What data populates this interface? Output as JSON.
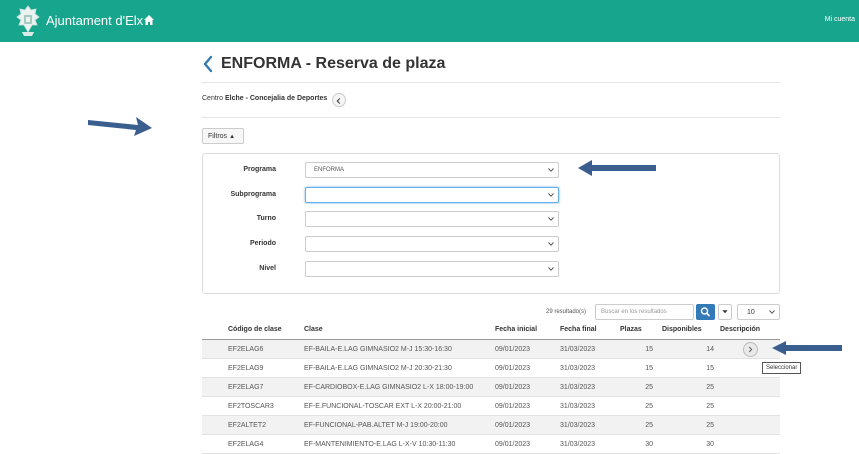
{
  "header": {
    "app_title": "Ajuntament d'Elx",
    "account_label": "Mi cuenta",
    "color": "#18a58d"
  },
  "page": {
    "title": "ENFORMA - Reserva de plaza",
    "centro_prefix": "Centro",
    "centro_name": "Elche - Concejalia de Deportes"
  },
  "filters": {
    "toggle_label": "Filtros",
    "fields": [
      {
        "label": "Programa",
        "value": "ENFORMA"
      },
      {
        "label": "Subprograma",
        "value": ""
      },
      {
        "label": "Turno",
        "value": ""
      },
      {
        "label": "Periodo",
        "value": ""
      },
      {
        "label": "Nivel",
        "value": ""
      }
    ]
  },
  "results": {
    "count_text": "29 resultado(s)",
    "search_placeholder": "Buscar en los resultados",
    "page_size": "10"
  },
  "table": {
    "columns": [
      "Código de clase",
      "Clase",
      "Fecha inicial",
      "Fecha final",
      "Plazas",
      "Disponibles",
      "Descripción"
    ],
    "rows": [
      [
        "EF2ELAG6",
        "EF-BAILA-E.LAG GIMNASIO2 M-J 15:30-16:30",
        "09/01/2023",
        "31/03/2023",
        "15",
        "14"
      ],
      [
        "EF2ELAG9",
        "EF-BAILA-E.LAG GIMNASIO2 M-J 20:30-21:30",
        "09/01/2023",
        "31/03/2023",
        "15",
        "15"
      ],
      [
        "EF2ELAG7",
        "EF-CARDIOBOX-E.LAG GIMNASIO2 L-X 18:00-19:00",
        "09/01/2023",
        "31/03/2023",
        "25",
        "25"
      ],
      [
        "EF2TOSCAR3",
        "EF-E.FUNCIONAL-TOSCAR EXT L-X 20:00-21:00",
        "09/01/2023",
        "31/03/2023",
        "25",
        "25"
      ],
      [
        "EF2ALTET2",
        "EF-FUNCIONAL-PAB.ALTET M-J 19:00-20:00",
        "09/01/2023",
        "31/03/2023",
        "25",
        "25"
      ],
      [
        "EF2ELAG4",
        "EF-MANTENIMIENTO-E.LAG L-X-V 10:30-11:30",
        "09/01/2023",
        "31/03/2023",
        "30",
        "30"
      ]
    ],
    "tooltip": "Seleccionar"
  },
  "annotation_color": "#3a5f8f"
}
